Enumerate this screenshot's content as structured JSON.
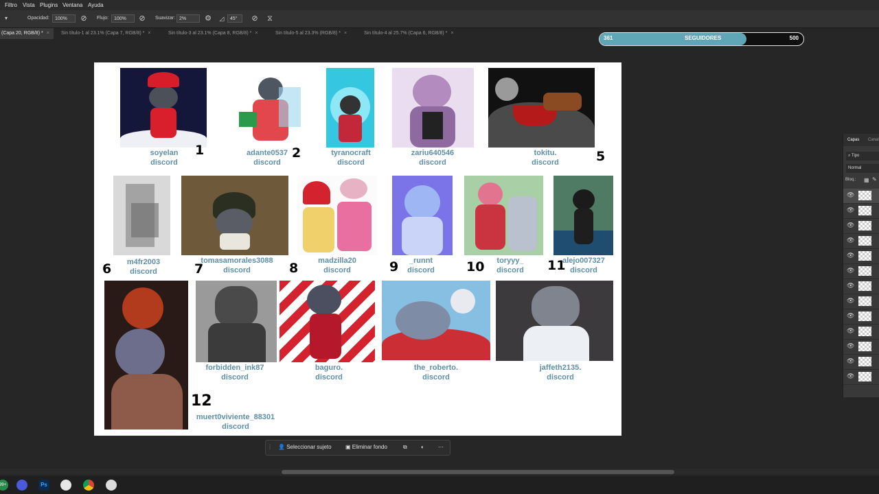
{
  "menubar": {
    "items": [
      "Filtro",
      "Vista",
      "Plugins",
      "Ventana",
      "Ayuda"
    ]
  },
  "options": {
    "opacity_label": "Opacidad:",
    "opacity_value": "100%",
    "flow_label": "Flujo:",
    "flow_value": "100%",
    "smooth_label": "Suavizar:",
    "smooth_value": "2%",
    "angle_value": "45°"
  },
  "tabs": [
    "(Capa 20, RGB/8) *",
    "Sin título-1 al 23.1% (Capa 7, RGB/8) *",
    "Sin título-3 al 23.1% (Capa 8, RGB/8) *",
    "Sin título-5 al 23.3% (RGB/8) *",
    "Sin título-4 al 25.7% (Capa 6, RGB/8) *"
  ],
  "followers": {
    "current": "361",
    "label": "SEGUIDORES",
    "goal": "500",
    "progress": 0.722
  },
  "canvas": {
    "entries": [
      {
        "user": "soyelan",
        "platform": "discord",
        "number": "1"
      },
      {
        "user": "adante0537",
        "platform": "discord",
        "number": "2"
      },
      {
        "user": "tyranocraft",
        "platform": "discord",
        "number": ""
      },
      {
        "user": "zariu640546",
        "platform": "discord",
        "number": ""
      },
      {
        "user": "tokitu.",
        "platform": "discord",
        "number": "5"
      },
      {
        "user": "m4fr2003",
        "platform": "discord",
        "number": "6"
      },
      {
        "user": "tomasamorales3088",
        "platform": "discord",
        "number": "7"
      },
      {
        "user": "madzilla20",
        "platform": "discord",
        "number": "8"
      },
      {
        "user": "_runnt",
        "platform": "discord",
        "number": "9"
      },
      {
        "user": "toryyy_",
        "platform": "discord",
        "number": "10"
      },
      {
        "user": "alejo007327",
        "platform": "discord",
        "number": "11"
      },
      {
        "user": "muert0viviente_88301",
        "platform": "discord",
        "number": "12"
      },
      {
        "user": "forbidden_ink87",
        "platform": "discord",
        "number": ""
      },
      {
        "user": "baguro.",
        "platform": "discord",
        "number": ""
      },
      {
        "user": "the_roberto.",
        "platform": "discord",
        "number": ""
      },
      {
        "user": "jaffeth2135.",
        "platform": "discord",
        "number": ""
      }
    ]
  },
  "layers_panel": {
    "tab_layers": "Capas",
    "tab_channels": "Canal",
    "filter": "Tipo",
    "blend": "Normal",
    "lock_label": "Bloq.:"
  },
  "context_bar": {
    "select_subject": "Seleccionar sujeto",
    "remove_bg": "Eliminar fondo"
  },
  "taskbar": {
    "badge": "99+"
  }
}
